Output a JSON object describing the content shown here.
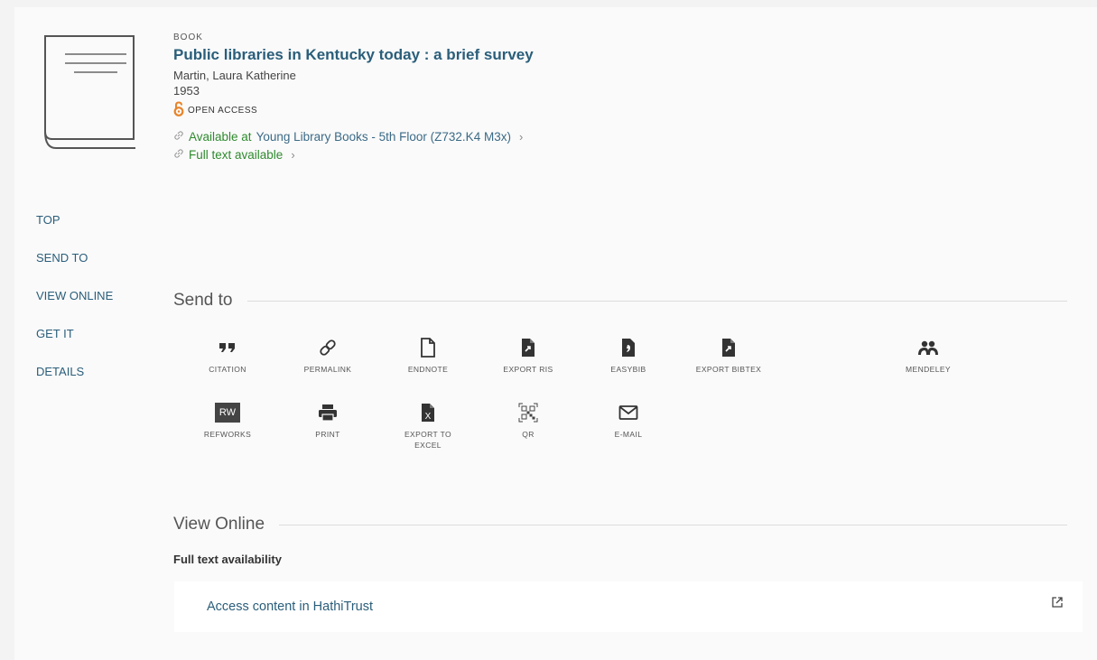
{
  "record": {
    "type": "BOOK",
    "title": "Public libraries in Kentucky today : a brief survey",
    "author": "Martin, Laura Katherine",
    "year": "1953",
    "open_access": "OPEN ACCESS",
    "availability": {
      "location_prefix": "Available at",
      "location": "Young Library  Books - 5th Floor (Z732.K4 M3x)",
      "fulltext": "Full text available"
    }
  },
  "sidenav": {
    "items": [
      "TOP",
      "SEND TO",
      "VIEW ONLINE",
      "GET IT",
      "DETAILS"
    ]
  },
  "send_to": {
    "heading": "Send to",
    "tools": [
      {
        "label": "CITATION",
        "icon": "quote-icon"
      },
      {
        "label": "PERMALINK",
        "icon": "link-icon"
      },
      {
        "label": "ENDNOTE",
        "icon": "document-icon"
      },
      {
        "label": "EXPORT RIS",
        "icon": "export-file-icon"
      },
      {
        "label": "EASYBIB",
        "icon": "easybib-icon"
      },
      {
        "label": "EXPORT BIBTEX",
        "icon": "export-file-icon"
      },
      {
        "label": "MENDELEY",
        "icon": "mendeley-icon"
      },
      {
        "label": "REFWORKS",
        "icon": "refworks-icon",
        "badge": "RW"
      },
      {
        "label": "PRINT",
        "icon": "printer-icon"
      },
      {
        "label": "EXPORT TO EXCEL",
        "icon": "excel-icon",
        "badge": "X"
      },
      {
        "label": "QR",
        "icon": "qr-code-icon"
      },
      {
        "label": "E-MAIL",
        "icon": "envelope-icon"
      }
    ]
  },
  "view_online": {
    "heading": "View Online",
    "subheading": "Full text availability",
    "link": "Access content in HathiTrust"
  },
  "colors": {
    "link": "#2a5e7a",
    "available": "#2f8a2f",
    "open_access": "#e8832a"
  }
}
